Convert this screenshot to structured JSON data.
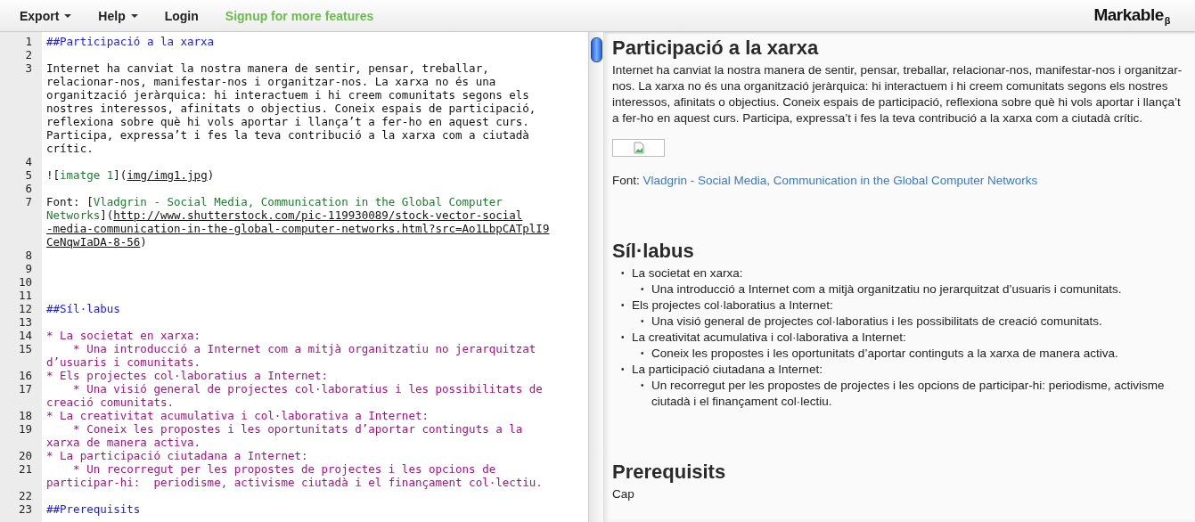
{
  "menu": [
    {
      "label": "Export",
      "kind": "dropdown"
    },
    {
      "label": "Help",
      "kind": "dropdown"
    },
    {
      "label": "Login",
      "kind": "link"
    },
    {
      "label": "Signup for more features",
      "kind": "promo"
    }
  ],
  "brand": {
    "name": "Markable",
    "badge": "β"
  },
  "editor": {
    "lines": [
      {
        "number": "1",
        "rows": [
          [
            {
              "kind": "heading",
              "text": "##Participació a la xarxa"
            }
          ]
        ]
      },
      {
        "number": "2"
      },
      {
        "number": "3",
        "rows": [
          [
            {
              "kind": "text",
              "text": "Internet ha canviat la nostra manera de sentir, pensar, treballar,"
            }
          ],
          [
            {
              "kind": "text",
              "text": "relacionar-nos, manifestar-nos i organitzar-nos. La xarxa no és una"
            }
          ],
          [
            {
              "kind": "text",
              "text": "organització jeràrquica: hi interactuem i hi creem comunitats segons els"
            }
          ],
          [
            {
              "kind": "text",
              "text": "nostres interessos, afinitats o objectius. Coneix espais de participació,"
            }
          ],
          [
            {
              "kind": "text",
              "text": "reflexiona sobre què hi vols aportar i llança’t a fer-ho en aquest curs."
            }
          ],
          [
            {
              "kind": "text",
              "text": "Participa, expressa’t i fes la teva contribució a la xarxa com a ciutadà"
            }
          ],
          [
            {
              "kind": "text",
              "text": "crític."
            }
          ]
        ]
      },
      {
        "number": "4"
      },
      {
        "number": "5",
        "rows": [
          [
            {
              "kind": "text",
              "text": "!["
            },
            {
              "kind": "label",
              "text": "imatge 1"
            },
            {
              "kind": "text",
              "text": "]("
            },
            {
              "kind": "url",
              "text": "img/img1.jpg"
            },
            {
              "kind": "text",
              "text": ")"
            }
          ]
        ]
      },
      {
        "number": "6"
      },
      {
        "number": "7",
        "rows": [
          [
            {
              "kind": "text",
              "text": "Font: ["
            },
            {
              "kind": "label",
              "text": "Vladgrin - Social Media, Communication in the Global Computer"
            }
          ],
          [
            {
              "kind": "label",
              "text": "Networks"
            },
            {
              "kind": "text",
              "text": "]("
            },
            {
              "kind": "url",
              "text": "http://www.shutterstock.com/pic-119930089/stock-vector-social"
            }
          ],
          [
            {
              "kind": "url",
              "text": "-media-communication-in-the-global-computer-networks.html?src=Ao1LbpCATplI9"
            }
          ],
          [
            {
              "kind": "url",
              "text": "CeNqwIaDA-8-56"
            },
            {
              "kind": "text",
              "text": ")"
            }
          ]
        ]
      },
      {
        "number": "8"
      },
      {
        "number": "9"
      },
      {
        "number": "10"
      },
      {
        "number": "11"
      },
      {
        "number": "12",
        "rows": [
          [
            {
              "kind": "heading",
              "text": "##Síl·labus"
            }
          ]
        ]
      },
      {
        "number": "13"
      },
      {
        "number": "14",
        "rows": [
          [
            {
              "kind": "list",
              "text": "* La societat en xarxa:"
            }
          ]
        ]
      },
      {
        "number": "15",
        "rows": [
          [
            {
              "kind": "list",
              "text": "    * Una introducció a Internet com a mitjà organitzatiu no jerarquitzat"
            }
          ],
          [
            {
              "kind": "list",
              "text": "d’usuaris i comunitats."
            }
          ]
        ]
      },
      {
        "number": "16",
        "rows": [
          [
            {
              "kind": "list",
              "text": "* Els projectes col·laboratius a Internet:"
            }
          ]
        ]
      },
      {
        "number": "17",
        "rows": [
          [
            {
              "kind": "list",
              "text": "    * Una visió general de projectes col·laboratius i les possibilitats de"
            }
          ],
          [
            {
              "kind": "list",
              "text": "creació comunitats."
            }
          ]
        ]
      },
      {
        "number": "18",
        "rows": [
          [
            {
              "kind": "list",
              "text": "* La creativitat acumulativa i col·laborativa a Internet:"
            }
          ]
        ]
      },
      {
        "number": "19",
        "rows": [
          [
            {
              "kind": "list",
              "text": "    * Coneix les propostes i les oportunitats d’aportar continguts a la"
            }
          ],
          [
            {
              "kind": "list",
              "text": "xarxa de manera activa."
            }
          ]
        ]
      },
      {
        "number": "20",
        "rows": [
          [
            {
              "kind": "list",
              "text": "* La participació ciutadana a Internet:"
            }
          ]
        ]
      },
      {
        "number": "21",
        "rows": [
          [
            {
              "kind": "list",
              "text": "    * Un recorregut per les propostes de projectes i les opcions de"
            }
          ],
          [
            {
              "kind": "list",
              "text": "participar-hi:  periodisme, activisme ciutadà i el finançament col·lectiu."
            }
          ]
        ]
      },
      {
        "number": "22"
      },
      {
        "number": "23",
        "rows": [
          [
            {
              "kind": "heading",
              "text": "##Prerequisits"
            }
          ]
        ]
      }
    ]
  },
  "preview": {
    "blocks": [
      {
        "kind": "heading",
        "text": "Participació a la xarxa"
      },
      {
        "kind": "paragraph",
        "text": "Internet ha canviat la nostra manera de sentir, pensar, treballar, relacionar-nos, manifestar-nos i organitzar-nos. La xarxa no és una organització jeràrquica: hi interactuem i hi creem comunitats segons els nostres interessos, afinitats o objectius. Coneix espais de participació, reflexiona sobre què hi vols aportar i llança’t a fer-ho en aquest curs. Participa, expressa’t i fes la teva contribució a la xarxa com a ciutadà crític."
      },
      {
        "kind": "image"
      },
      {
        "kind": "credit",
        "label": "Font:",
        "link": "Vladgrin - Social Media, Communication in the Global Computer Networks"
      },
      {
        "kind": "heading",
        "text": "Síl·labus"
      },
      {
        "kind": "list",
        "items": [
          {
            "bullet": "•",
            "text": "La societat en xarxa:",
            "children": [
              {
                "bullet": "•",
                "text": "Una introducció a Internet com a mitjà organitzatiu no jerarquitzat d’usuaris i comunitats."
              }
            ]
          },
          {
            "bullet": "•",
            "text": "Els projectes col·laboratius a Internet:",
            "children": [
              {
                "bullet": "•",
                "text": "Una visió general de projectes col·laboratius i les possibilitats de creació comunitats."
              }
            ]
          },
          {
            "bullet": "•",
            "text": "La creativitat acumulativa i col·laborativa a Internet:",
            "children": [
              {
                "bullet": "•",
                "text": "Coneix les propostes i les oportunitats d’aportar continguts a la xarxa de manera activa."
              }
            ]
          },
          {
            "bullet": "•",
            "text": "La participació ciutadana a Internet:",
            "children": [
              {
                "bullet": "•",
                "text": "Un recorregut per les propostes de projectes i les opcions de participar-hi: periodisme, activisme ciutadà i el finançament col·lectiu."
              }
            ]
          }
        ]
      },
      {
        "kind": "heading",
        "text": "Prerequisits"
      },
      {
        "kind": "paragraph",
        "text": "Cap"
      }
    ]
  }
}
